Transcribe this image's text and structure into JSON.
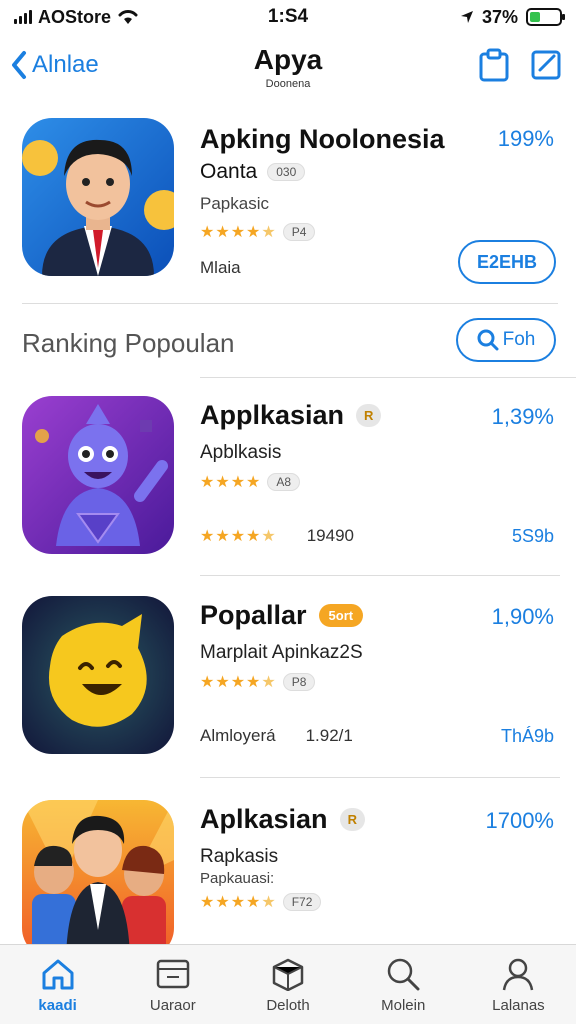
{
  "status": {
    "carrier": "AOStore",
    "time": "1:S4",
    "battery": "37%",
    "battery_level": 0.37
  },
  "nav": {
    "back_label": "Alnlae",
    "title": "Apya",
    "subtitle": "Doonena"
  },
  "featured": {
    "title": "Apking Noolonesia",
    "percent": "199%",
    "developer": "Oanta",
    "developer_badge": "030",
    "category": "Papkasic",
    "rating_badge": "P4",
    "size": "Mlaia",
    "get_label": "E2EHB"
  },
  "section": {
    "title": "Ranking Popoulan",
    "button_label": "Foh"
  },
  "apps": [
    {
      "title": "Applkasian",
      "badge": "R",
      "percent": "1,39%",
      "subtitle": "Apblkasis",
      "rating_badge": "A8",
      "foot_label": "",
      "foot_count": "19490",
      "size": "5S9b",
      "badge_style": "grey"
    },
    {
      "title": "Popallar",
      "badge": "5ort",
      "percent": "1,90%",
      "subtitle": "Marplait Apinkaz2S",
      "rating_badge": "P8",
      "foot_label": "Almloyerá",
      "foot_count": "1.92/1",
      "size": "ThÁ9b",
      "badge_style": "orange"
    },
    {
      "title": "Aplkasian",
      "badge": "R",
      "percent": "1700%",
      "subtitle": "Rapkasis",
      "extra": "Papkauasi:",
      "rating_badge": "F72",
      "foot_label": "",
      "foot_count": "",
      "size": "",
      "badge_style": "grey"
    }
  ],
  "tabs": [
    {
      "label": "kaadi",
      "icon": "home-icon"
    },
    {
      "label": "Uaraor",
      "icon": "screen-icon"
    },
    {
      "label": "Deloth",
      "icon": "box-icon"
    },
    {
      "label": "Molein",
      "icon": "search-icon"
    },
    {
      "label": "Lalanas",
      "icon": "person-icon"
    }
  ],
  "colors": {
    "accent": "#1b7fe0",
    "star": "#f5a623",
    "badge_orange": "#f5a623"
  }
}
